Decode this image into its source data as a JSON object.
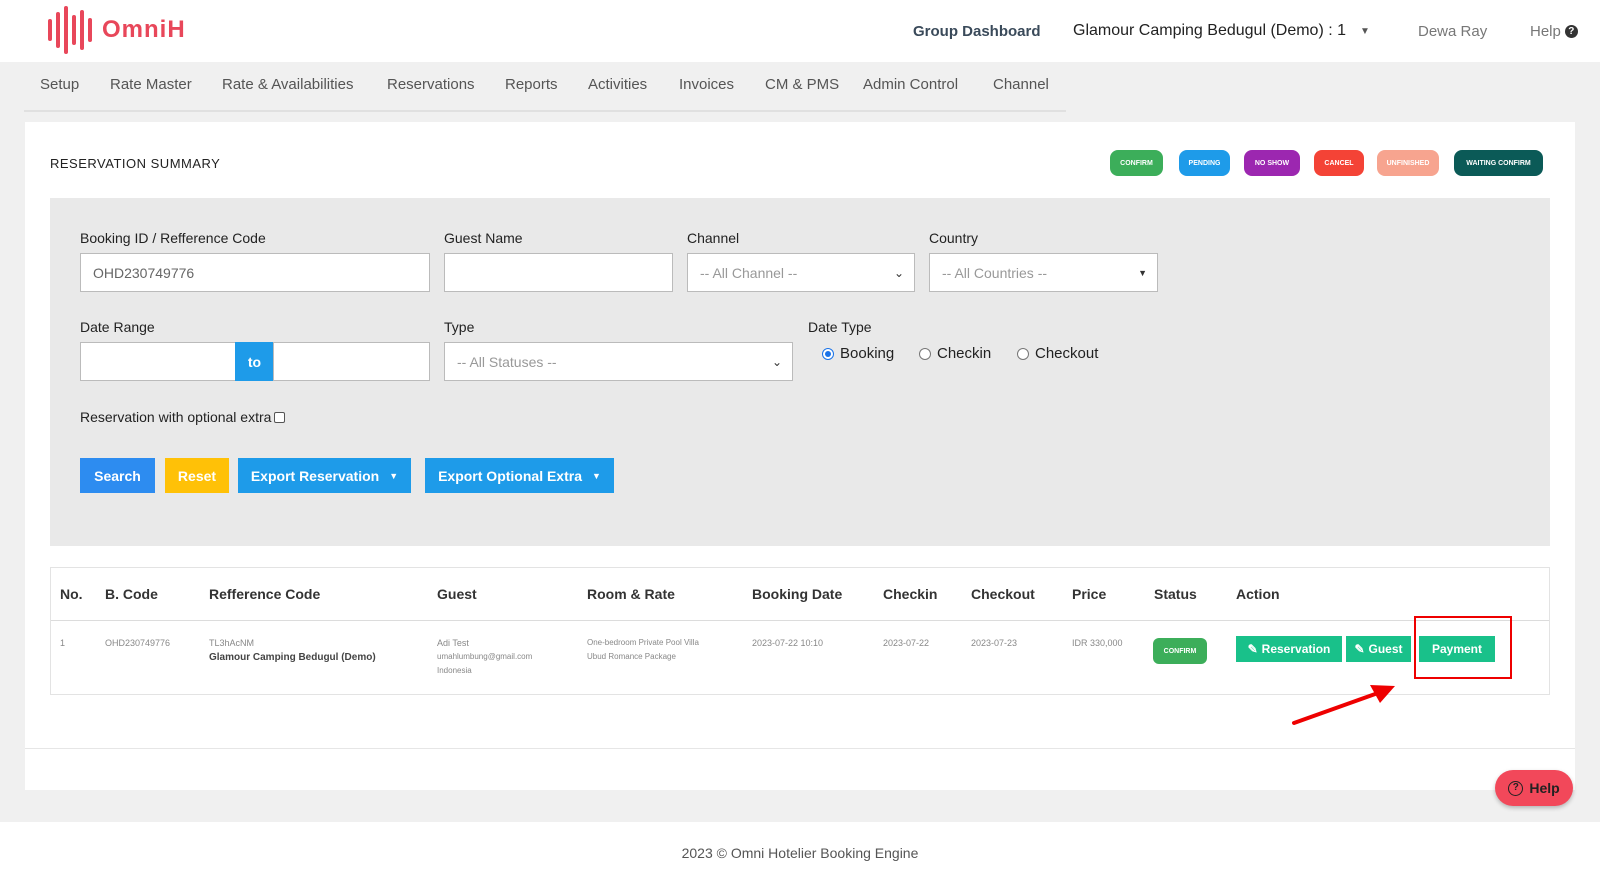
{
  "header": {
    "logo_text": "OmniH",
    "group_dashboard": "Group Dashboard",
    "property": "Glamour Camping Bedugul (Demo) : 1",
    "user": "Dewa Ray",
    "help": "Help",
    "brand_color": "#e8475a"
  },
  "nav": {
    "items": [
      "Setup",
      "Rate Master",
      "Rate & Availabilities",
      "Reservations",
      "Reports",
      "Activities",
      "Invoices",
      "CM & PMS",
      "Admin Control",
      "Channel"
    ]
  },
  "summary": {
    "title": "RESERVATION SUMMARY",
    "legend": [
      {
        "label": "CONFIRM",
        "color": "#3cae5a"
      },
      {
        "label": "PENDING",
        "color": "#1e9be9"
      },
      {
        "label": "NO SHOW",
        "color": "#9c27b0"
      },
      {
        "label": "CANCEL",
        "color": "#f44336"
      },
      {
        "label": "UNFINISHED",
        "color": "#f7a48f"
      },
      {
        "label": "WAITING CONFIRM",
        "color": "#0b5a57"
      }
    ]
  },
  "filters": {
    "booking_id_label": "Booking ID / Refference Code",
    "booking_id_value": "OHD230749776",
    "guest_name_label": "Guest Name",
    "guest_name_value": "",
    "channel_label": "Channel",
    "channel_value": "-- All Channel --",
    "country_label": "Country",
    "country_value": "-- All Countries --",
    "date_range_label": "Date Range",
    "date_to": "to",
    "type_label": "Type",
    "type_value": "-- All Statuses --",
    "date_type_label": "Date Type",
    "date_type_options": [
      "Booking",
      "Checkin",
      "Checkout"
    ],
    "date_type_selected": "Booking",
    "optional_extra_label": "Reservation with optional extra"
  },
  "buttons": {
    "search": "Search",
    "reset": "Reset",
    "export_reservation": "Export Reservation",
    "export_optional_extra": "Export Optional Extra"
  },
  "table": {
    "headers": [
      "No.",
      "B. Code",
      "Refference Code",
      "Guest",
      "Room & Rate",
      "Booking Date",
      "Checkin",
      "Checkout",
      "Price",
      "Status",
      "Action"
    ],
    "rows": [
      {
        "no": "1",
        "b_code": "OHD230749776",
        "ref_code": "TL3hAcNM",
        "property": "Glamour Camping Bedugul (Demo)",
        "guest_name": "Adi Test",
        "guest_email": "umahlumbung@gmail.com",
        "guest_country": "Indonesia",
        "room": "One-bedroom Private Pool Villa",
        "rate": "Ubud Romance Package",
        "booking_date": "2023-07-22 10:10",
        "checkin": "2023-07-22",
        "checkout": "2023-07-23",
        "price": "IDR 330,000",
        "status": "CONFIRM",
        "actions": [
          "Reservation",
          "Guest",
          "Payment"
        ]
      }
    ]
  },
  "help_button": "Help",
  "footer": "2023 © Omni Hotelier Booking Engine"
}
